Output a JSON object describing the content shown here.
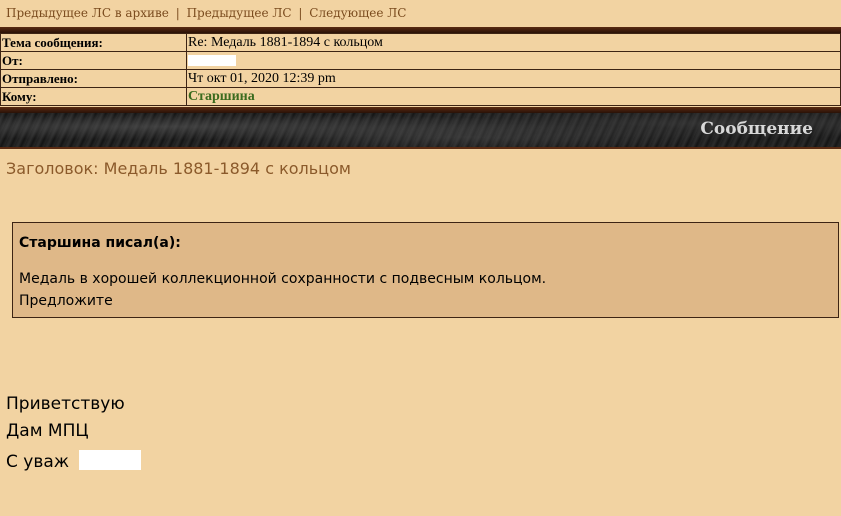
{
  "nav": {
    "prev_archive": "Предыдущее ЛС в архиве",
    "prev": "Предыдущее ЛС",
    "next": "Следующее ЛС",
    "separator": "|"
  },
  "header": {
    "subject_label": "Тема сообщения:",
    "subject_value": "Re: Медаль 1881-1894 с кольцом",
    "from_label": "От:",
    "sent_label": "Отправлено:",
    "sent_value": "Чт окт 01, 2020 12:39 pm",
    "to_label": "Кому:",
    "to_value": "Старшина"
  },
  "banner": {
    "title": "Сообщение"
  },
  "message": {
    "subject_line": "Заголовок: Медаль 1881-1894 с кольцом",
    "quote_author": "Старшина писал(а):",
    "quote_line1": "Медаль в хорошей коллекционной сохранности с подвесным кольцом.",
    "quote_line2": "Предложите",
    "body_line1": "Приветствую",
    "body_line2": "Дам МПЦ",
    "body_line3": "С уваж"
  },
  "colors": {
    "background": "#f2d3a2",
    "quote_background": "#dfb888",
    "subject_text": "#8b5a2b",
    "recipient_text": "#3a6b1e",
    "border_brown": "#5a2b12"
  }
}
